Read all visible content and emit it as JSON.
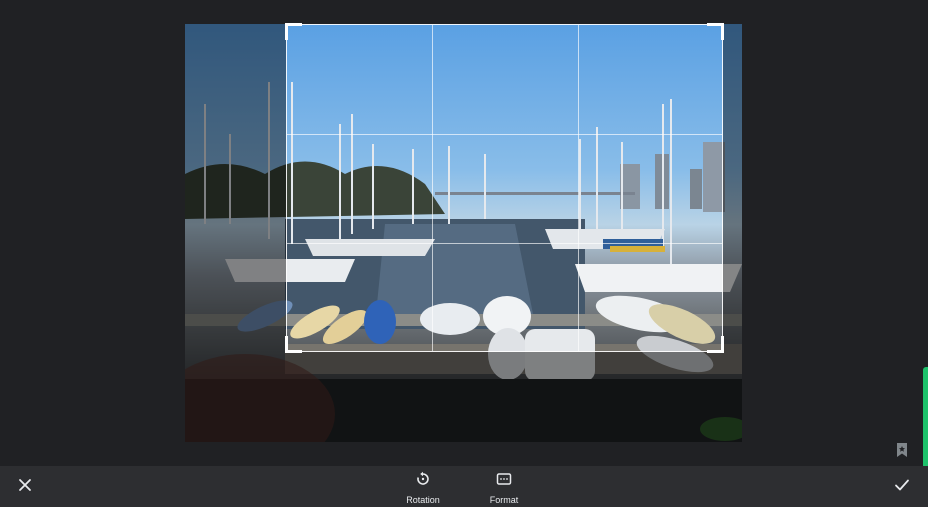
{
  "toolbar": {
    "close_icon": "close-icon",
    "confirm_icon": "check-icon",
    "tools": [
      {
        "label": "Rotation",
        "icon": "rotation-icon"
      },
      {
        "label": "Format",
        "icon": "aspect-ratio-icon"
      }
    ]
  },
  "colors": {
    "background": "#202124",
    "toolbar": "#2d2e31",
    "accent": "#1ec26b"
  },
  "photo": {
    "subject": "marina-boats-image"
  }
}
